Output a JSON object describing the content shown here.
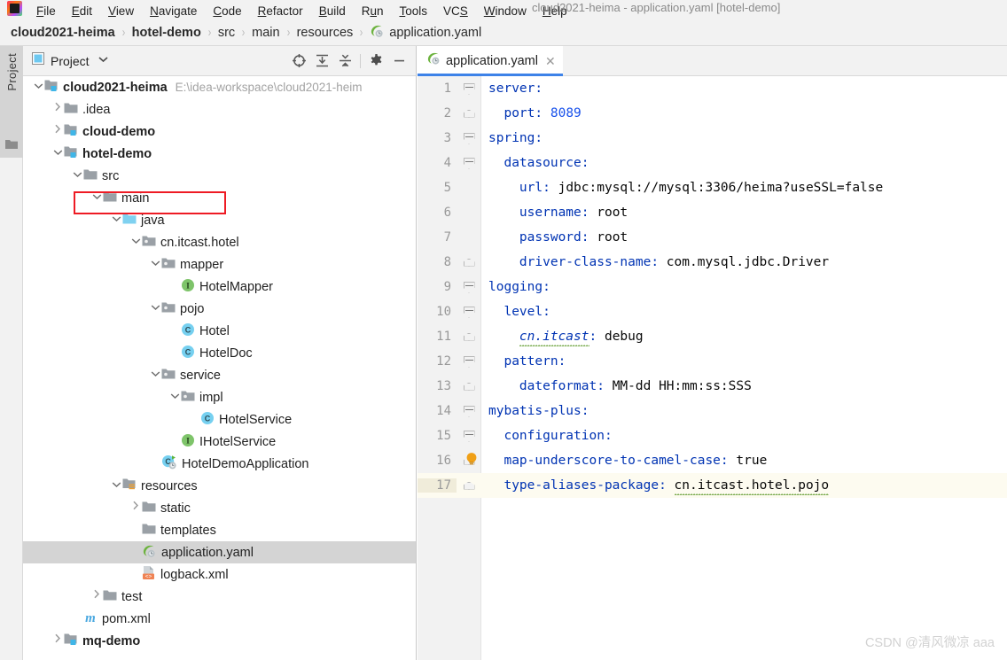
{
  "window": {
    "title": "cloud2021-heima - application.yaml [hotel-demo]",
    "logo_icon": "intellij-idea-logo-icon"
  },
  "menubar": {
    "items": [
      {
        "label": "File",
        "mnemonic": "F"
      },
      {
        "label": "Edit",
        "mnemonic": "E"
      },
      {
        "label": "View",
        "mnemonic": "V"
      },
      {
        "label": "Navigate",
        "mnemonic": "N"
      },
      {
        "label": "Code",
        "mnemonic": "C"
      },
      {
        "label": "Refactor",
        "mnemonic": "R"
      },
      {
        "label": "Build",
        "mnemonic": "B"
      },
      {
        "label": "Run",
        "mnemonic": "u"
      },
      {
        "label": "Tools",
        "mnemonic": "T"
      },
      {
        "label": "VCS",
        "mnemonic": "S"
      },
      {
        "label": "Window",
        "mnemonic": "W"
      },
      {
        "label": "Help",
        "mnemonic": "H"
      }
    ]
  },
  "breadcrumb": {
    "separator": "›",
    "items": [
      {
        "label": "cloud2021-heima",
        "bold": true,
        "icon": null
      },
      {
        "label": "hotel-demo",
        "bold": true,
        "icon": null
      },
      {
        "label": "src",
        "bold": false,
        "icon": null
      },
      {
        "label": "main",
        "bold": false,
        "icon": null
      },
      {
        "label": "resources",
        "bold": false,
        "icon": null
      },
      {
        "label": "application.yaml",
        "bold": false,
        "icon": "spring-yaml-icon"
      }
    ]
  },
  "toolstrip": {
    "label": "Project",
    "folder_icon": "folder-icon"
  },
  "project_panel": {
    "title": "Project",
    "view_icon": "project-view-icon",
    "dropdown_icon": "chevron-down-icon",
    "toolbar": [
      {
        "name": "select-opened-file-icon",
        "title": "Select Opened File"
      },
      {
        "name": "expand-all-icon",
        "title": "Expand All"
      },
      {
        "name": "collapse-all-icon",
        "title": "Collapse All"
      },
      {
        "name": "settings-gear-icon",
        "title": "Settings"
      },
      {
        "name": "hide-panel-icon",
        "title": "Hide"
      }
    ],
    "highlight_color": "#ee1b24",
    "selected_row": "application.yaml",
    "tree": [
      {
        "depth": 0,
        "twisty": "down",
        "icon": "module-folder-icon",
        "label": "cloud2021-heima",
        "bold": true,
        "path": "E:\\idea-workspace\\cloud2021-heim"
      },
      {
        "depth": 1,
        "twisty": "right",
        "icon": "folder-icon",
        "label": ".idea",
        "bold": false,
        "path": ""
      },
      {
        "depth": 1,
        "twisty": "right",
        "icon": "module-folder-icon",
        "label": "cloud-demo",
        "bold": true,
        "path": ""
      },
      {
        "depth": 1,
        "twisty": "down",
        "icon": "module-folder-icon",
        "label": "hotel-demo",
        "bold": true,
        "path": ""
      },
      {
        "depth": 2,
        "twisty": "down",
        "icon": "folder-icon",
        "label": "src",
        "bold": false,
        "path": ""
      },
      {
        "depth": 3,
        "twisty": "down",
        "icon": "folder-icon",
        "label": "main",
        "bold": false,
        "path": ""
      },
      {
        "depth": 4,
        "twisty": "down",
        "icon": "source-root-icon",
        "label": "java",
        "bold": false,
        "path": ""
      },
      {
        "depth": 5,
        "twisty": "down",
        "icon": "package-icon",
        "label": "cn.itcast.hotel",
        "bold": false,
        "path": ""
      },
      {
        "depth": 6,
        "twisty": "down",
        "icon": "package-icon",
        "label": "mapper",
        "bold": false,
        "path": ""
      },
      {
        "depth": 7,
        "twisty": "none",
        "icon": "interface-icon",
        "label": "HotelMapper",
        "bold": false,
        "path": ""
      },
      {
        "depth": 6,
        "twisty": "down",
        "icon": "package-icon",
        "label": "pojo",
        "bold": false,
        "path": ""
      },
      {
        "depth": 7,
        "twisty": "none",
        "icon": "class-icon",
        "label": "Hotel",
        "bold": false,
        "path": ""
      },
      {
        "depth": 7,
        "twisty": "none",
        "icon": "class-icon",
        "label": "HotelDoc",
        "bold": false,
        "path": ""
      },
      {
        "depth": 6,
        "twisty": "down",
        "icon": "package-icon",
        "label": "service",
        "bold": false,
        "path": ""
      },
      {
        "depth": 7,
        "twisty": "down",
        "icon": "package-icon",
        "label": "impl",
        "bold": false,
        "path": ""
      },
      {
        "depth": 8,
        "twisty": "none",
        "icon": "class-icon",
        "label": "HotelService",
        "bold": false,
        "path": ""
      },
      {
        "depth": 7,
        "twisty": "none",
        "icon": "interface-icon",
        "label": "IHotelService",
        "bold": false,
        "path": ""
      },
      {
        "depth": 6,
        "twisty": "none",
        "icon": "spring-boot-class-icon",
        "label": "HotelDemoApplication",
        "bold": false,
        "path": ""
      },
      {
        "depth": 4,
        "twisty": "down",
        "icon": "resource-root-icon",
        "label": "resources",
        "bold": false,
        "path": ""
      },
      {
        "depth": 5,
        "twisty": "right",
        "icon": "folder-icon",
        "label": "static",
        "bold": false,
        "path": ""
      },
      {
        "depth": 5,
        "twisty": "none",
        "icon": "folder-icon",
        "label": "templates",
        "bold": false,
        "path": ""
      },
      {
        "depth": 5,
        "twisty": "none",
        "icon": "spring-yaml-icon",
        "label": "application.yaml",
        "bold": false,
        "path": ""
      },
      {
        "depth": 5,
        "twisty": "none",
        "icon": "xml-file-icon",
        "label": "logback.xml",
        "bold": false,
        "path": ""
      },
      {
        "depth": 3,
        "twisty": "right",
        "icon": "folder-icon",
        "label": "test",
        "bold": false,
        "path": ""
      },
      {
        "depth": 2,
        "twisty": "none",
        "icon": "maven-pom-icon",
        "label": "pom.xml",
        "bold": false,
        "path": ""
      },
      {
        "depth": 1,
        "twisty": "right",
        "icon": "module-folder-icon",
        "label": "mq-demo",
        "bold": true,
        "path": ""
      }
    ]
  },
  "editor": {
    "tab": {
      "label": "application.yaml",
      "icon": "spring-yaml-icon",
      "close_icon": "close-icon",
      "active": true
    },
    "current_line": 17,
    "lines": [
      {
        "n": 1,
        "fold": "open",
        "indent": 0,
        "key": "server",
        "sep": ":",
        "value": "",
        "bulb": false
      },
      {
        "n": 2,
        "fold": "leaf",
        "indent": 1,
        "key": "port",
        "sep": ":",
        "value": "8089",
        "bulb": false,
        "value_type": "number"
      },
      {
        "n": 3,
        "fold": "open",
        "indent": 0,
        "key": "spring",
        "sep": ":",
        "value": "",
        "bulb": false
      },
      {
        "n": 4,
        "fold": "open",
        "indent": 1,
        "key": "datasource",
        "sep": ":",
        "value": "",
        "bulb": false
      },
      {
        "n": 5,
        "fold": "none",
        "indent": 2,
        "key": "url",
        "sep": ":",
        "value": "jdbc:mysql://mysql:3306/heima?useSSL=false",
        "bulb": false
      },
      {
        "n": 6,
        "fold": "none",
        "indent": 2,
        "key": "username",
        "sep": ":",
        "value": "root",
        "bulb": false
      },
      {
        "n": 7,
        "fold": "none",
        "indent": 2,
        "key": "password",
        "sep": ":",
        "value": "root",
        "bulb": false
      },
      {
        "n": 8,
        "fold": "leaf",
        "indent": 2,
        "key": "driver-class-name",
        "sep": ":",
        "value": "com.mysql.jdbc.Driver",
        "bulb": false
      },
      {
        "n": 9,
        "fold": "open",
        "indent": 0,
        "key": "logging",
        "sep": ":",
        "value": "",
        "bulb": false
      },
      {
        "n": 10,
        "fold": "open",
        "indent": 1,
        "key": "level",
        "sep": ":",
        "value": "",
        "bulb": false
      },
      {
        "n": 11,
        "fold": "leaf",
        "indent": 2,
        "key": "cn.itcast",
        "sep": ":",
        "value": "debug",
        "bulb": false,
        "key_style": "italic-warn"
      },
      {
        "n": 12,
        "fold": "open",
        "indent": 1,
        "key": "pattern",
        "sep": ":",
        "value": "",
        "bulb": false
      },
      {
        "n": 13,
        "fold": "leaf",
        "indent": 2,
        "key": "dateformat",
        "sep": ":",
        "value": "MM-dd HH:mm:ss:SSS",
        "bulb": false
      },
      {
        "n": 14,
        "fold": "open",
        "indent": 0,
        "key": "mybatis-plus",
        "sep": ":",
        "value": "",
        "bulb": false
      },
      {
        "n": 15,
        "fold": "open",
        "indent": 1,
        "key": "configuration",
        "sep": ":",
        "value": "",
        "bulb": false
      },
      {
        "n": 16,
        "fold": "leaf",
        "indent": 1,
        "key": "map-underscore-to-camel-case",
        "sep": ":",
        "value": "true",
        "bulb": true
      },
      {
        "n": 17,
        "fold": "leaf",
        "indent": 1,
        "key": "type-aliases-package",
        "sep": ":",
        "value": "cn.itcast.hotel.pojo",
        "bulb": false,
        "value_style": "warn"
      }
    ]
  },
  "watermark": "CSDN @清风微凉 aaa",
  "colors": {
    "accent_tab": "#3d82e8",
    "yaml_key": "#0033b3",
    "yaml_number": "#1750eb",
    "highlight_box": "#ee1b24",
    "current_line_bg": "#fdfbf0",
    "selection_bg": "#d4d4d4"
  }
}
